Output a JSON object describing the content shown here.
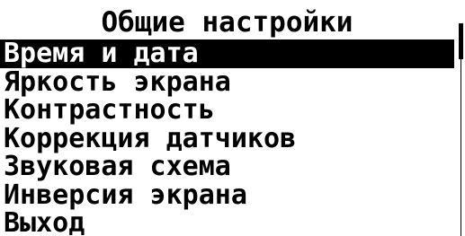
{
  "screen": {
    "title": "Общие настройки"
  },
  "menu": {
    "selected_index": 0,
    "items": [
      {
        "label": "Время и дата"
      },
      {
        "label": "Яркость экрана"
      },
      {
        "label": "Контрастность"
      },
      {
        "label": "Коррекция датчиков"
      },
      {
        "label": "Звуковая схема"
      },
      {
        "label": "Инверсия экрана"
      },
      {
        "label": "Выход"
      }
    ]
  },
  "scrollbar": {
    "position_fraction": 0.0
  },
  "colors": {
    "background": "#ffffff",
    "foreground": "#000000",
    "selection_background": "#000000",
    "selection_text": "#ffffff"
  }
}
